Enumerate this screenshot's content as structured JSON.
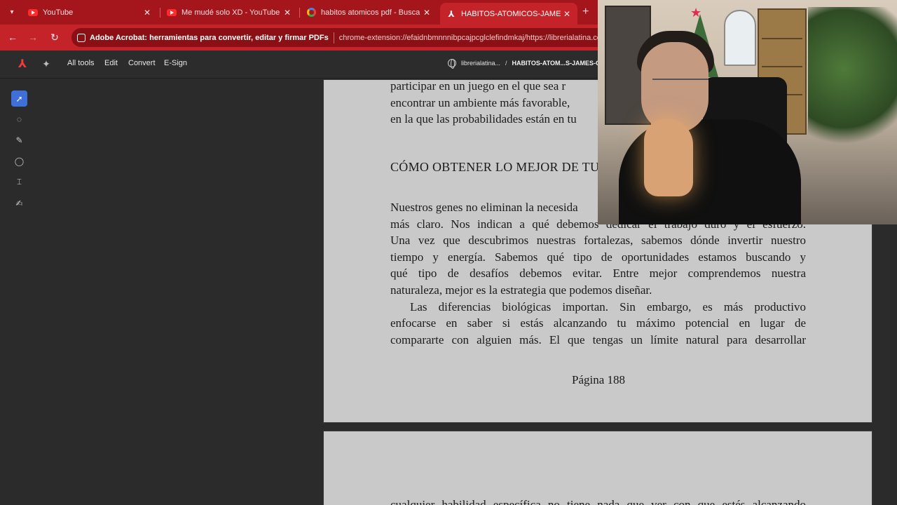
{
  "browser": {
    "tabs": [
      {
        "title": "YouTube",
        "icon": "youtube-icon",
        "active": false
      },
      {
        "title": "Me mudé solo XD - YouTube",
        "icon": "youtube-icon",
        "active": false
      },
      {
        "title": "habitos atomicos pdf - Buscar c",
        "icon": "google-icon",
        "active": false
      },
      {
        "title": "HABITOS-ATOMICOS-JAMES-C",
        "icon": "acrobat-icon",
        "active": true
      }
    ],
    "omnibox": {
      "extension_name": "Adobe Acrobat: herramientas para convertir, editar y firmar PDFs",
      "url": "chrome-extension://efaidnbmnnnibpcajpcglclefindmkaj/https://librerialatina.co/wp"
    }
  },
  "acrobat": {
    "menu": {
      "all_tools": "All tools",
      "edit": "Edit",
      "convert": "Convert",
      "esign": "E-Sign"
    },
    "breadcrumb": {
      "site": "librerialatina...",
      "separator": "/",
      "document": "HABITOS-ATOM...S-JAMES-C"
    },
    "tools": [
      "select-tool-icon",
      "comment-tool-icon",
      "draw-tool-icon",
      "lasso-tool-icon",
      "text-select-tool-icon",
      "sign-tool-icon"
    ]
  },
  "page1": {
    "top_lines": [
      "participar en un juego en el que sea r",
      "encontrar un ambiente más favorable,",
      "en la que las probabilidades están en tu"
    ],
    "heading": "CÓMO OBTENER LO MEJOR DE TU",
    "para1": [
      "Nuestros genes no eliminan la necesida",
      "más claro. Nos indican a qué debemos dedicar el trabajo duro y el esfuerzo.",
      "Una vez que descubrimos nuestras fortalezas, sabemos dónde invertir nuestro",
      "tiempo y energía. Sabemos qué tipo de oportunidades estamos buscando y",
      "qué tipo de desafíos debemos evitar. Entre mejor comprendemos nuestra",
      "naturaleza, mejor es la estrategia que podemos diseñar."
    ],
    "para2": [
      "Las diferencias biológicas importan. Sin embargo, es más productivo",
      "enfocarse en saber si estás alcanzando tu máximo potencial en lugar de",
      "compararte con alguien más. El que tengas un límite natural para desarrollar"
    ],
    "page_number": "Página 188"
  },
  "page2": {
    "first_line": "cualquier habilidad específica no tiene nada que ver con que estés alcanzando"
  }
}
